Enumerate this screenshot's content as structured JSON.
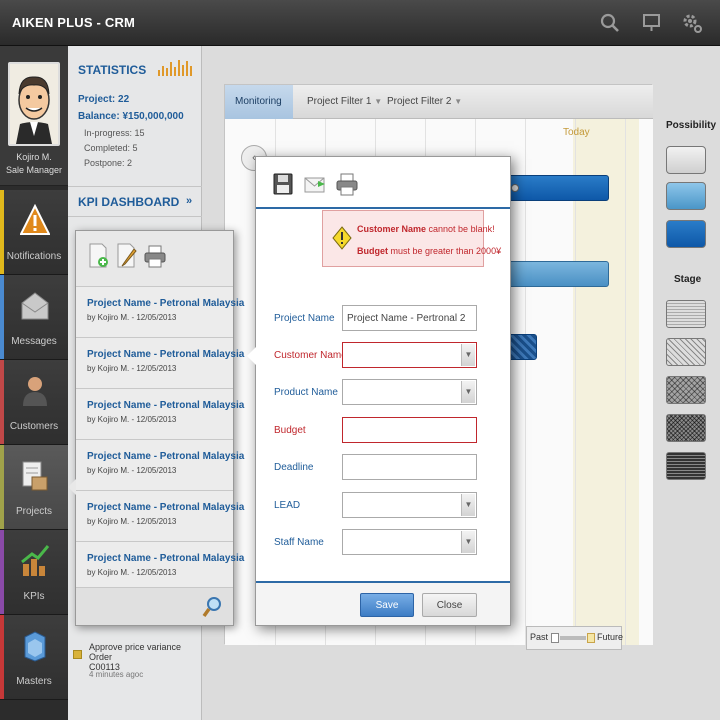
{
  "app": {
    "title": "AIKEN PLUS - CRM"
  },
  "topbar": {
    "icons": [
      "search-icon",
      "monitor-icon",
      "settings-icon"
    ]
  },
  "user": {
    "name": "Kojiro M.",
    "role": "Sale Manager"
  },
  "nav": [
    {
      "label": "Notifications",
      "icon": "warning-icon",
      "color": "#e0b81c"
    },
    {
      "label": "Messages",
      "icon": "envelope-icon",
      "color": "#4a8ad0"
    },
    {
      "label": "Customers",
      "icon": "user-icon",
      "color": "#c04848"
    },
    {
      "label": "Projects",
      "icon": "projects-icon",
      "color": "#a0a24a",
      "active": true
    },
    {
      "label": "KPIs",
      "icon": "kpi-chart-icon",
      "color": "#8a4aa8"
    },
    {
      "label": "Masters",
      "icon": "masters-icon",
      "color": "#c63838"
    }
  ],
  "stats": {
    "title": "STATISTICS",
    "project": "Project: 22",
    "balance": "Balance: ¥150,000,000",
    "in_progress": "In-progress: 15",
    "completed": "Completed: 5",
    "postpone": "Postpone: 2"
  },
  "kpi": {
    "title": "KPI DASHBOARD"
  },
  "activity": {
    "text_line1": "Approve price variance Order",
    "text_line2": "C00113",
    "time": "4 minutes agoc"
  },
  "chart": {
    "tabs": [
      "Monitoring",
      "Project Filter 1",
      "Project Filter 2"
    ],
    "today_label": "Today",
    "slider": {
      "left": "Past",
      "right": "Future"
    }
  },
  "legend": {
    "possibility_title": "Possibility",
    "stage_title": "Stage"
  },
  "projects": {
    "items": [
      {
        "name": "Project Name - Petronal Malaysia",
        "by": "by Kojiro M. - 12/05/2013"
      },
      {
        "name": "Project Name - Petronal Malaysia",
        "by": "by Kojiro M. - 12/05/2013"
      },
      {
        "name": "Project Name - Petronal Malaysia",
        "by": "by Kojiro M. - 12/05/2013"
      },
      {
        "name": "Project Name - Petronal Malaysia",
        "by": "by Kojiro M. - 12/05/2013"
      },
      {
        "name": "Project Name - Petronal Malaysia",
        "by": "by Kojiro M. - 12/05/2013"
      },
      {
        "name": "Project Name - Petronal Malaysia",
        "by": "by Kojiro M. - 12/05/2013"
      }
    ]
  },
  "form": {
    "errors": {
      "customer_bold": "Customer Name",
      "customer_rest": " cannot be blank!",
      "budget_bold": "Budget",
      "budget_rest": " must be greater than 2000¥"
    },
    "fields": {
      "project_name": {
        "label": "Project Name",
        "value": "Project Name - Pertronal 2"
      },
      "customer_name": {
        "label": "Customer Name",
        "value": ""
      },
      "product_name": {
        "label": "Product Name",
        "value": ""
      },
      "budget": {
        "label": "Budget",
        "value": ""
      },
      "deadline": {
        "label": "Deadline",
        "value": ""
      },
      "lead": {
        "label": "LEAD",
        "value": ""
      },
      "staff_name": {
        "label": "Staff Name",
        "value": ""
      }
    },
    "save_label": "Save",
    "close_label": "Close"
  }
}
